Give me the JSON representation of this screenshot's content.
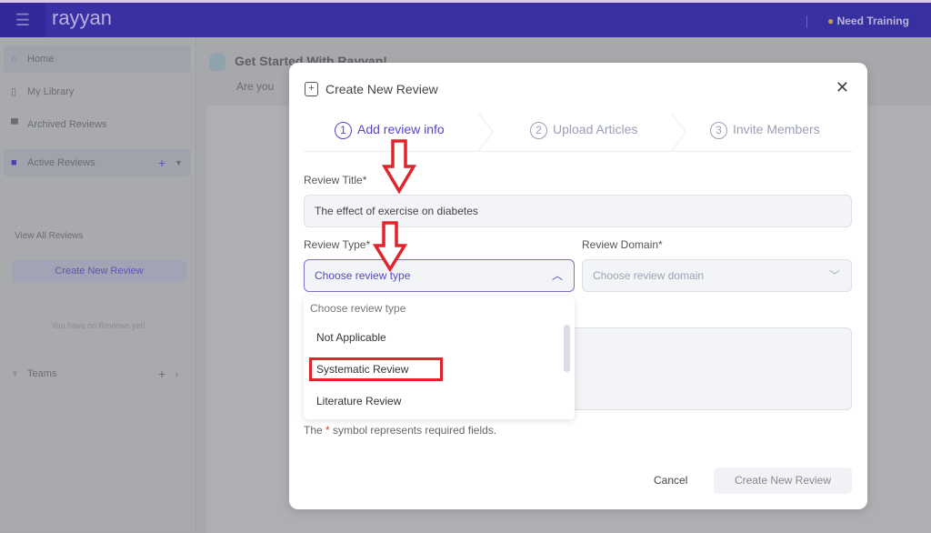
{
  "header": {
    "logo": "rayyan",
    "training": "Need Training"
  },
  "sidebar": {
    "items": [
      {
        "label": "Home"
      },
      {
        "label": "My Library"
      },
      {
        "label": "Archived Reviews"
      },
      {
        "label": "Active Reviews"
      },
      {
        "label": "Teams"
      }
    ],
    "view_all": "View All Reviews",
    "create": "Create New Review",
    "empty": "You have no Reviews yet!"
  },
  "main": {
    "title": "Get Started With Rayyan!",
    "subtitle": "Are you"
  },
  "modal": {
    "title": "Create New Review",
    "steps": [
      {
        "num": "1",
        "label": "Add review info"
      },
      {
        "num": "2",
        "label": "Upload Articles"
      },
      {
        "num": "3",
        "label": "Invite Members"
      }
    ],
    "review_title_label": "Review Title*",
    "review_title_value": "The effect of exercise on diabetes",
    "review_type_label": "Review Type*",
    "review_type_value": "Choose review type",
    "review_domain_label": "Review Domain*",
    "review_domain_value": "Choose review domain",
    "dropdown": {
      "placeholder": "Choose review type",
      "options": [
        "Not Applicable",
        "Systematic Review",
        "Literature Review"
      ]
    },
    "note_pre": "The",
    "note_ast": "*",
    "note_post": "symbol represents required fields.",
    "cancel": "Cancel",
    "create": "Create New Review"
  },
  "colors": {
    "header": "#3a2fa3",
    "accent": "#5448c8",
    "annotation": "#e2232b"
  }
}
